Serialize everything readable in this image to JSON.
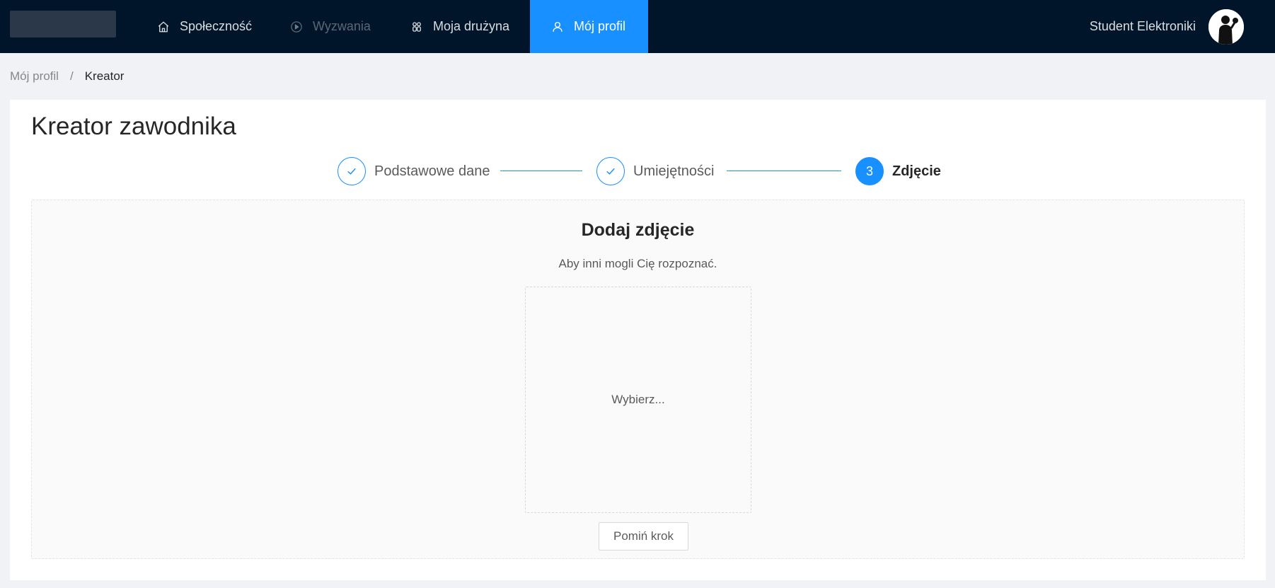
{
  "nav": {
    "items": [
      {
        "label": "Społeczność",
        "icon": "home-icon",
        "state": "normal"
      },
      {
        "label": "Wyzwania",
        "icon": "play-circle-icon",
        "state": "disabled"
      },
      {
        "label": "Moja drużyna",
        "icon": "team-icon",
        "state": "normal"
      },
      {
        "label": "Mój profil",
        "icon": "user-icon",
        "state": "active"
      }
    ],
    "user_name": "Student Elektroniki",
    "accent_color": "#1890ff",
    "background_color": "#001529"
  },
  "breadcrumb": {
    "items": [
      "Mój profil",
      "Kreator"
    ],
    "separator": "/"
  },
  "page": {
    "title": "Kreator zawodnika"
  },
  "steps": [
    {
      "label": "Podstawowe dane",
      "status": "finish",
      "icon": "check-icon"
    },
    {
      "label": "Umiejętności",
      "status": "finish",
      "icon": "check-icon"
    },
    {
      "label": "Zdjęcie",
      "status": "process",
      "number": "3"
    }
  ],
  "upload": {
    "title": "Dodaj zdjęcie",
    "subtitle": "Aby inni mogli Cię rozpoznać.",
    "select_label": "Wybierz...",
    "skip_label": "Pomiń krok"
  }
}
